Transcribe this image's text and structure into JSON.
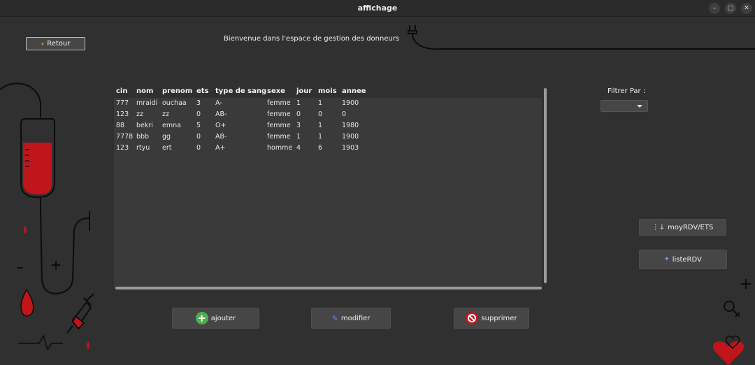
{
  "window": {
    "title": "affichage"
  },
  "header": {
    "back_label": "Retour",
    "welcome": "Bienvenue dans l'espace de gestion des donneurs"
  },
  "table": {
    "columns": [
      "cin",
      "nom",
      "prenom",
      "ets",
      "type de sang",
      "sexe",
      "jour",
      "mois",
      "annee"
    ],
    "rows": [
      [
        "777",
        "mraidi",
        "ouchaa",
        "3",
        "A-",
        "femme",
        "1",
        "1",
        "1900"
      ],
      [
        "123",
        "zz",
        "zz",
        "0",
        "AB-",
        "femme",
        "0",
        "0",
        "0"
      ],
      [
        "88",
        "bekri",
        "emna",
        "5",
        "O+",
        "femme",
        "3",
        "1",
        "1980"
      ],
      [
        "7778",
        "bbb",
        "gg",
        "0",
        "AB-",
        "femme",
        "1",
        "1",
        "1900"
      ],
      [
        "123",
        "rtyu",
        "ert",
        "0",
        "A+",
        "homme",
        "4",
        "6",
        "1903"
      ]
    ]
  },
  "filter": {
    "label": "Filtrer Par :",
    "value": ""
  },
  "actions": {
    "ajouter": "ajouter",
    "modifier": "modifier",
    "supprimer": "supprimer",
    "moy": "moyRDV/ETS",
    "liste": "listeRDV"
  },
  "colors": {
    "blood": "#c0151b",
    "accent_green": "#4caf50"
  }
}
